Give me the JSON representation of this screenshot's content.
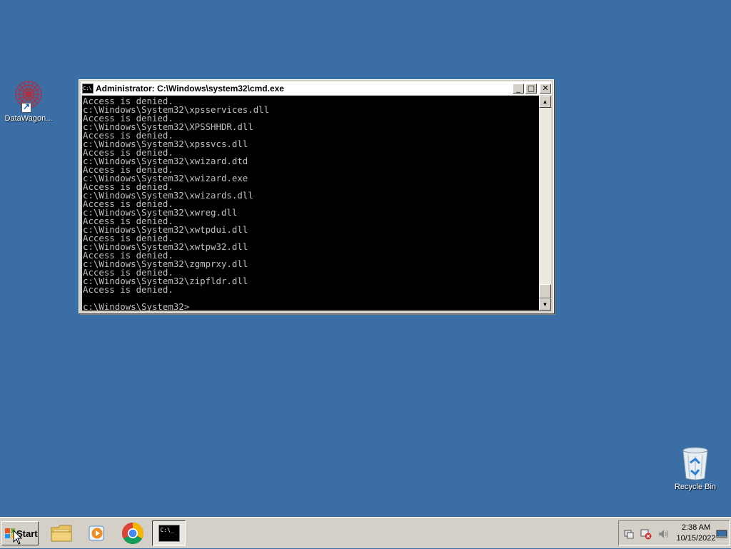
{
  "desktop": {
    "icons": [
      {
        "label": "DataWagon..."
      },
      {
        "label": "Recycle Bin"
      }
    ]
  },
  "cmd_window": {
    "title": "Administrator: C:\\Windows\\system32\\cmd.exe",
    "icon_text": "C:\\",
    "buttons": {
      "minimize": "_",
      "maximize": "□",
      "close": "✕"
    },
    "console_lines": [
      "Access is denied.",
      "c:\\Windows\\System32\\xpsservices.dll",
      "Access is denied.",
      "c:\\Windows\\System32\\XPSSHHDR.dll",
      "Access is denied.",
      "c:\\Windows\\System32\\xpssvcs.dll",
      "Access is denied.",
      "c:\\Windows\\System32\\xwizard.dtd",
      "Access is denied.",
      "c:\\Windows\\System32\\xwizard.exe",
      "Access is denied.",
      "c:\\Windows\\System32\\xwizards.dll",
      "Access is denied.",
      "c:\\Windows\\System32\\xwreg.dll",
      "Access is denied.",
      "c:\\Windows\\System32\\xwtpdui.dll",
      "Access is denied.",
      "c:\\Windows\\System32\\xwtpw32.dll",
      "Access is denied.",
      "c:\\Windows\\System32\\zgmprxy.dll",
      "Access is denied.",
      "c:\\Windows\\System32\\zipfldr.dll",
      "Access is denied.",
      "",
      "c:\\Windows\\System32>"
    ]
  },
  "taskbar": {
    "start_label": "Start",
    "apps": [
      "windows-explorer-icon",
      "media-player-icon",
      "chrome-icon",
      "command-prompt-icon"
    ],
    "cmd_icon_text": "C:\\_",
    "clock": {
      "time": "2:38 AM",
      "date": "10/15/2022"
    }
  }
}
